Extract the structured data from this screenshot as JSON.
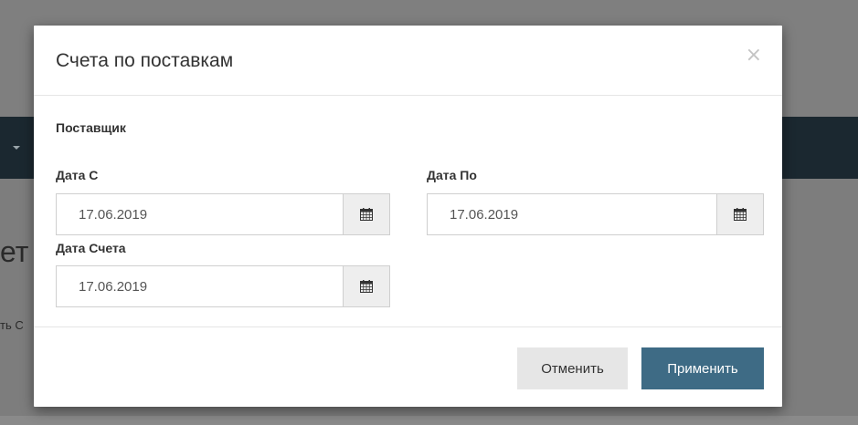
{
  "background": {
    "heading_fragment": "ет",
    "link_fragment": "ть С"
  },
  "modal": {
    "title": "Счета по поставкам",
    "close_glyph": "×",
    "supplier_label": "Поставщик",
    "date_from": {
      "label": "Дата С",
      "value": "17.06.2019"
    },
    "date_to": {
      "label": "Дата По",
      "value": "17.06.2019"
    },
    "invoice_date": {
      "label": "Дата Счета",
      "value": "17.06.2019"
    },
    "calendar_icon": "calendar-icon",
    "footer": {
      "cancel_label": "Отменить",
      "apply_label": "Применить"
    },
    "colors": {
      "apply_button": "#3e6b85",
      "cancel_button": "#e6e6e6",
      "navbar": "#1b2830"
    }
  }
}
